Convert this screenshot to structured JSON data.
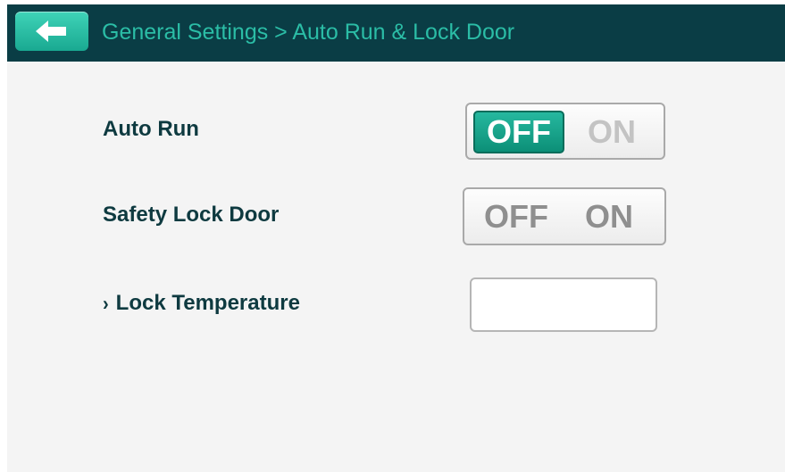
{
  "header": {
    "breadcrumb": "General Settings > Auto Run & Lock Door",
    "back_icon": "arrow-left-icon"
  },
  "settings": {
    "auto_run": {
      "label": "Auto Run",
      "off_label": "OFF",
      "on_label": "ON",
      "value": "OFF"
    },
    "safety_lock_door": {
      "label": "Safety Lock Door",
      "off_label": "OFF",
      "on_label": "ON",
      "value": ""
    },
    "lock_temperature": {
      "label": "Lock Temperature",
      "chevron": "›",
      "value": ""
    }
  },
  "colors": {
    "header_bg": "#0a3d45",
    "accent": "#19a991",
    "breadcrumb_text": "#2bbda6",
    "label_text": "#0e3a40",
    "page_bg": "#f4f4f4"
  }
}
